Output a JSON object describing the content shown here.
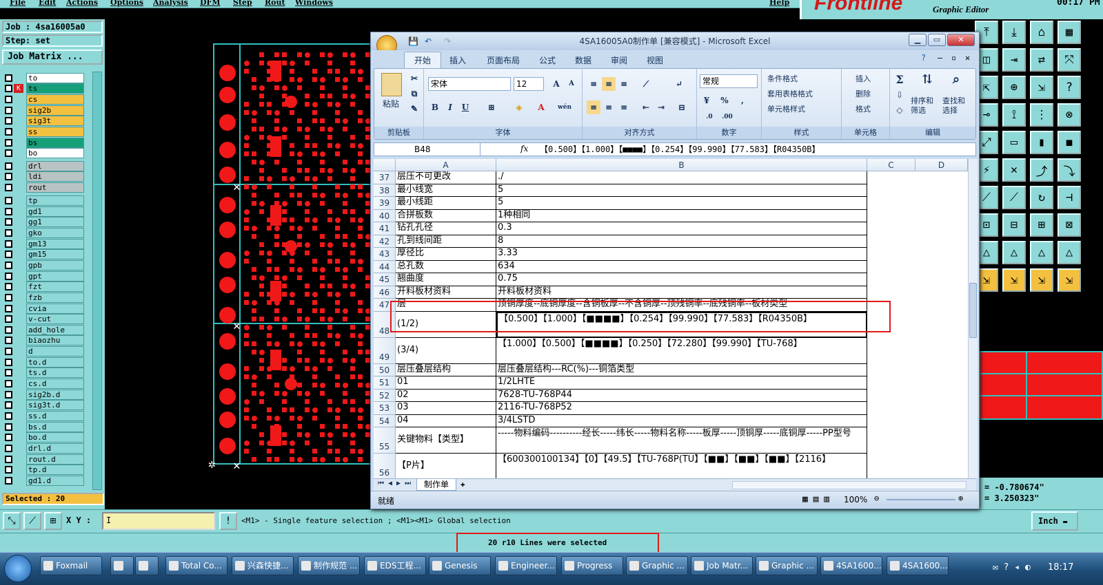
{
  "menu": [
    "File",
    "Edit",
    "Actions",
    "Options",
    "Analysis",
    "DFM",
    "Step",
    "Rout",
    "Windows"
  ],
  "help": "Help",
  "brand": {
    "logo": "Frontline",
    "subtitle": "Graphic Editor",
    "time": "00:17 PM"
  },
  "job": {
    "label": "Job : 4sa16005a0",
    "step": "Step: set",
    "matrix_button": "Job Matrix ..."
  },
  "layers": [
    "to",
    "ts",
    "cs",
    "sig2b",
    "sig3t",
    "ss",
    "bs",
    "bo",
    "drl",
    "ldi",
    "rout",
    "tp",
    "gd1",
    "gg1",
    "gko",
    "gm13",
    "gm15",
    "gpb",
    "gpt",
    "fzt",
    "fzb",
    "cvia",
    "v-cut",
    "add_hole",
    "biaozhu",
    "d",
    "to.d",
    "ts.d",
    "cs.d",
    "sig2b.d",
    "sig3t.d",
    "ss.d",
    "bs.d",
    "bo.d",
    "drl.d",
    "rout.d",
    "tp.d",
    "gd1.d"
  ],
  "layer_colors": {
    "white": "#ffffff",
    "teal": "#16a07a",
    "amber": "#f4c040",
    "grey": "#b8c4c4",
    "aqua": "#8fd8d8"
  },
  "selected": "Selected : 20",
  "coords": {
    "x": "= -0.780674\"",
    "y": "= 3.250323\""
  },
  "cmd": {
    "xy_label": "X Y :",
    "xy_value": "I",
    "hint": "<M1> - Single feature selection ; <M1><M1> Global selection",
    "units": "Inch"
  },
  "message": "20 r10 Lines were selected",
  "excel": {
    "title": "4SA16005A0制作单  [兼容模式] - Microsoft Excel",
    "tabs": [
      "开始",
      "插入",
      "页面布局",
      "公式",
      "数据",
      "审阅",
      "视图"
    ],
    "groups": [
      "剪贴板",
      "字体",
      "对齐方式",
      "数字",
      "样式",
      "单元格",
      "编辑"
    ],
    "paste": "粘贴",
    "font_name": "宋体",
    "font_size": "12",
    "number_format": "常规",
    "style_items": [
      "条件格式",
      "套用表格格式",
      "单元格样式"
    ],
    "cell_items": [
      "插入",
      "删除",
      "格式"
    ],
    "edit_items": [
      "排序和筛选",
      "查找和选择"
    ],
    "name_box": "B48",
    "fx": "fx",
    "formula": "【0.500】【1.000】【■■■■】【0.254】【99.990】【77.583】【R04350B】",
    "columns": [
      "A",
      "B",
      "C",
      "D"
    ],
    "rows": [
      {
        "n": "37",
        "a": "层压不可更改",
        "b": "./"
      },
      {
        "n": "38",
        "a": "最小线宽",
        "b": "5"
      },
      {
        "n": "39",
        "a": "最小线距",
        "b": "5"
      },
      {
        "n": "40",
        "a": "合拼板数",
        "b": "1种相同"
      },
      {
        "n": "41",
        "a": "钻孔孔径",
        "b": "0.3"
      },
      {
        "n": "42",
        "a": "孔到线间距",
        "b": "8"
      },
      {
        "n": "43",
        "a": "厚径比",
        "b": "3.33"
      },
      {
        "n": "44",
        "a": "总孔数",
        "b": "634"
      },
      {
        "n": "45",
        "a": "翘曲度",
        "b": "0.75"
      },
      {
        "n": "46",
        "a": "开料板材资料",
        "b": "开料板材资料"
      },
      {
        "n": "47",
        "a": "层",
        "b": "顶铜厚度--底铜厚度--含铜板厚--不含铜厚--顶残铜率--底残铜率--板材类型"
      },
      {
        "n": "48",
        "a": "(1/2)",
        "b": "【0.500】【1.000】【■■■■】【0.254】【99.990】【77.583】【R04350B】"
      },
      {
        "n": "49",
        "a": "(3/4)",
        "b": "【1.000】【0.500】【■■■■】【0.250】【72.280】【99.990】【TU-768】"
      },
      {
        "n": "50",
        "a": "层压叠层结构",
        "b": "层压叠层结构---RC(%)---铜箔类型"
      },
      {
        "n": "51",
        "a": "01",
        "b": "1/2LHTE"
      },
      {
        "n": "52",
        "a": "02",
        "b": "7628-TU-768P44"
      },
      {
        "n": "53",
        "a": "03",
        "b": "2116-TU-768P52"
      },
      {
        "n": "54",
        "a": "04",
        "b": "3/4LSTD"
      },
      {
        "n": "55",
        "a": "关键物料【类型】",
        "b": "-----物料编码----------经长-----纬长-----物料名称-----板厚-----顶铜厚-----底铜厚-----PP型号"
      },
      {
        "n": "56",
        "a": "【P片】",
        "b": "【600300100134】【0】【49.5】【TU-768P(TU】【■■】【■■】【■■】【2116】"
      }
    ],
    "sheet_tab": "制作单",
    "status": "就绪",
    "zoom": "100%"
  },
  "taskbar": [
    "Foxmail",
    "",
    "",
    "Total Co...",
    "兴森快捷...",
    "制作规范 ...",
    "EDS工程...",
    "Genesis",
    "Engineer...",
    "Progress",
    "Graphic ...",
    "Job Matr...",
    "Graphic ...",
    "4SA1600...",
    "4SA1600..."
  ],
  "clock": "18:17"
}
